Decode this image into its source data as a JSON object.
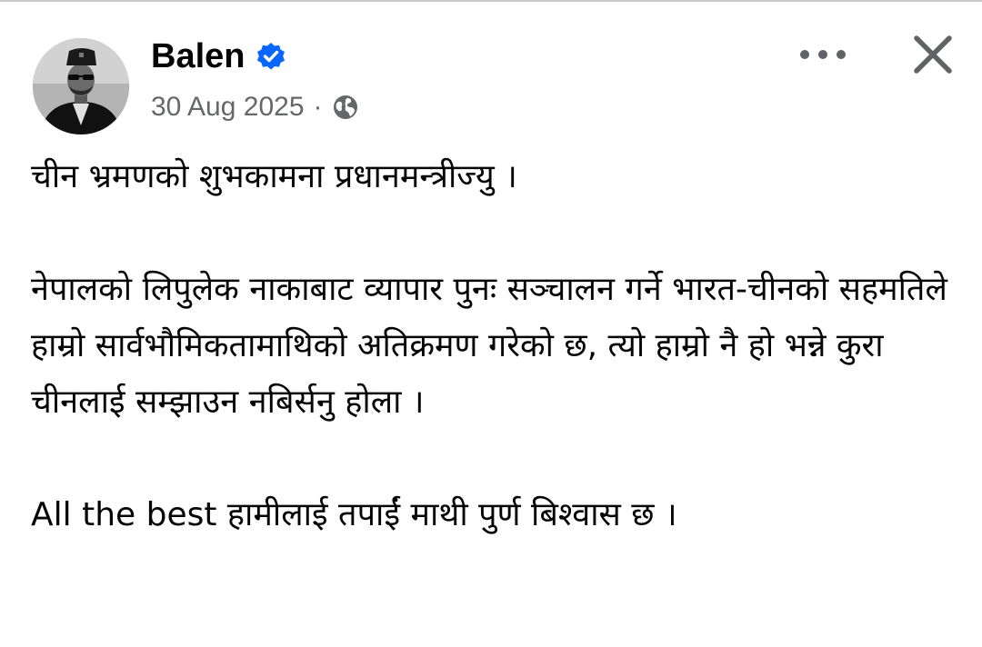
{
  "post": {
    "author": "Balen",
    "date": "30 Aug 2025",
    "separator": "·",
    "visibility_icon": "globe-icon",
    "verified_icon": "verified-badge-icon",
    "more_icon": "more-options-icon",
    "close_icon": "close-icon",
    "paragraphs": [
      "चीन भ्रमणको शुभकामना प्रधानमन्त्रीज्यु ।",
      "नेपालको लिपुलेक नाकाबाट व्यापार पुनः सञ्चालन गर्ने भारत-चीनको सहमतिले हाम्रो सार्वभौमिकतामाथिको अतिक्रमण गरेको छ, त्यो हाम्रो नै हो भन्ने कुरा चीनलाई सम्झाउन नबिर्सनु होला ।",
      "All the best हामीलाई तपाईं माथी पुर्ण बिश्वास छ ।"
    ]
  },
  "colors": {
    "verified_blue": "#0866ff",
    "meta_gray": "#65676b",
    "text": "#050505",
    "icon_gray": "#606266"
  }
}
